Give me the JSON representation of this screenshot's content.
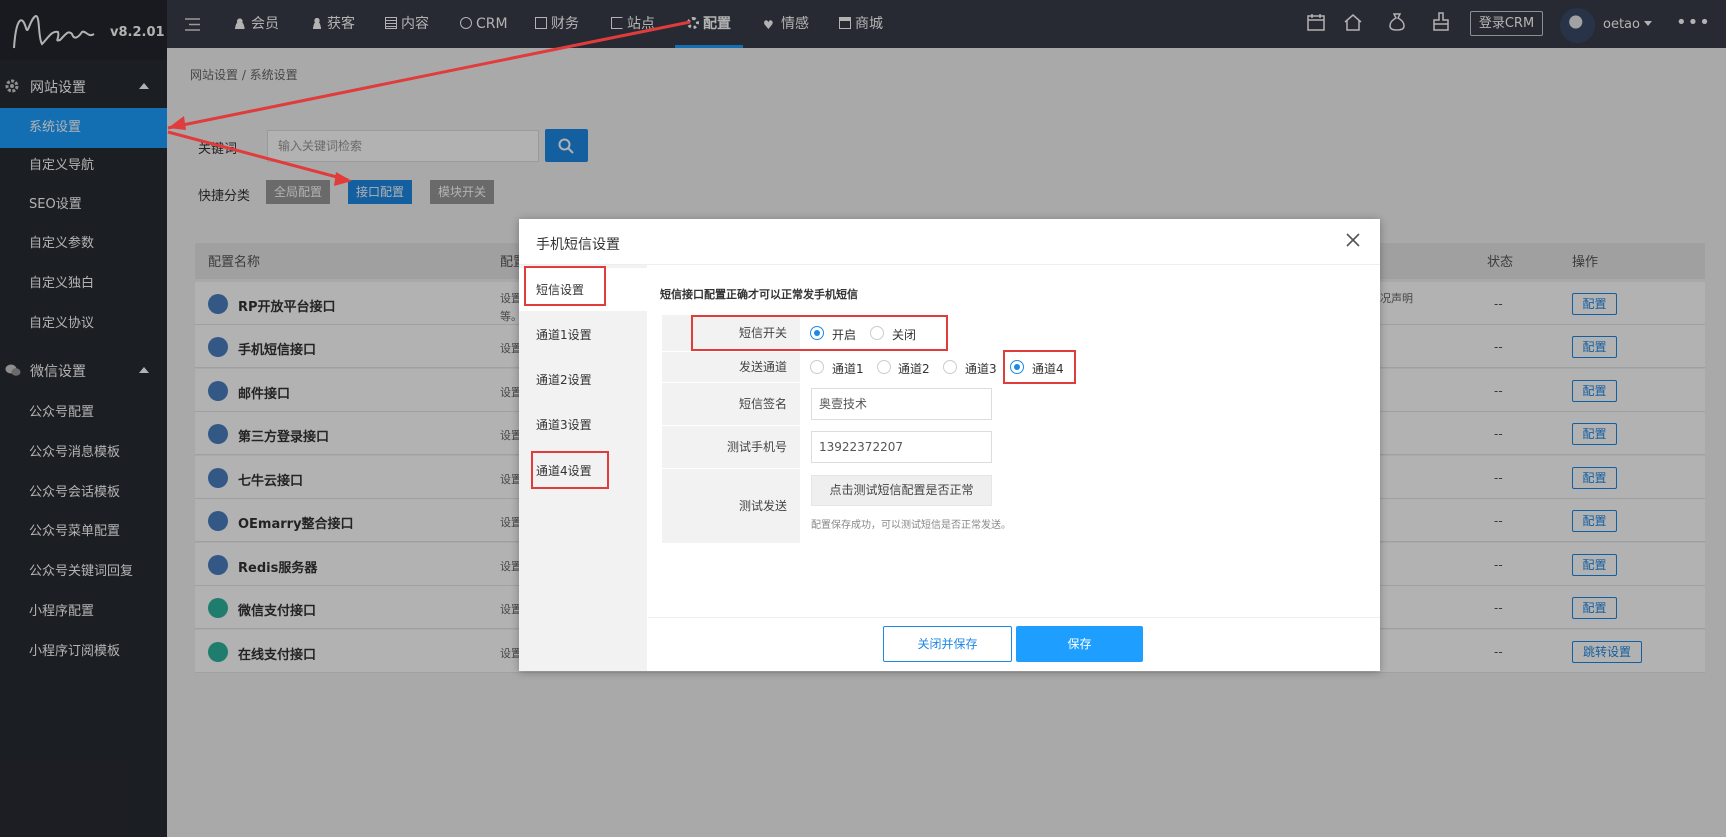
{
  "app": {
    "version": "v8.2.01"
  },
  "sidebar": {
    "groups": [
      {
        "label": "网站设置",
        "items": [
          "系统设置",
          "自定义导航",
          "SEO设置",
          "自定义参数",
          "自定义独白",
          "自定义协议"
        ]
      },
      {
        "label": "微信设置",
        "items": [
          "公众号配置",
          "公众号消息模板",
          "公众号会话模板",
          "公众号菜单配置",
          "公众号关键词回复",
          "小程序配置",
          "小程序订阅模板"
        ]
      }
    ],
    "active_item": "系统设置"
  },
  "topnav": {
    "items": [
      "会员",
      "获客",
      "内容",
      "CRM",
      "财务",
      "站点",
      "配置",
      "情感",
      "商城"
    ],
    "active": "配置",
    "login_crm": "登录CRM",
    "username": "oetao",
    "more": "•••"
  },
  "breadcrumb": "网站设置 / 系统设置",
  "search": {
    "label": "关键词",
    "placeholder": "输入关键词检索"
  },
  "quick": {
    "label": "快捷分类",
    "buttons": [
      "全局配置",
      "接口配置",
      "模块开关"
    ],
    "active": "接口配置"
  },
  "table": {
    "headers": [
      "配置名称",
      "配置",
      "状态",
      "操作"
    ],
    "rows": [
      {
        "name": "RP开放平台接口",
        "desc": "设置",
        "desc2": "等。",
        "desc_right": "况声明",
        "status": "--",
        "action": "配置"
      },
      {
        "name": "手机短信接口",
        "desc": "设置",
        "status": "--",
        "action": "配置"
      },
      {
        "name": "邮件接口",
        "desc": "设置",
        "status": "--",
        "action": "配置"
      },
      {
        "name": "第三方登录接口",
        "desc": "设置",
        "status": "--",
        "action": "配置"
      },
      {
        "name": "七牛云接口",
        "desc": "设置",
        "status": "--",
        "action": "配置"
      },
      {
        "name": "OEmarry整合接口",
        "desc": "设置",
        "status": "--",
        "action": "配置"
      },
      {
        "name": "Redis服务器",
        "desc": "设置",
        "status": "--",
        "action": "配置"
      },
      {
        "name": "微信支付接口",
        "desc": "设置",
        "status": "--",
        "action": "配置"
      },
      {
        "name": "在线支付接口",
        "desc": "设置",
        "status": "--",
        "action": "跳转设置"
      }
    ]
  },
  "modal": {
    "title": "手机短信设置",
    "tabs": [
      "短信设置",
      "通道1设置",
      "通道2设置",
      "通道3设置",
      "通道4设置"
    ],
    "note": "短信接口配置正确才可以正常发手机短信",
    "fields": {
      "switch_label": "短信开关",
      "switch_options": [
        "开启",
        "关闭"
      ],
      "switch_value": "开启",
      "channel_label": "发送通道",
      "channel_options": [
        "通道1",
        "通道2",
        "通道3",
        "通道4"
      ],
      "channel_value": "通道4",
      "sign_label": "短信签名",
      "sign_value": "奥壹技术",
      "phone_label": "测试手机号",
      "phone_value": "13922372207",
      "test_label": "测试发送",
      "test_button": "点击测试短信配置是否正常",
      "test_hint": "配置保存成功，可以测试短信是否正常发送。"
    },
    "buttons": {
      "close_save": "关闭并保存",
      "save": "保存"
    }
  },
  "colors": {
    "accent": "#1e9fff",
    "sidebar_bg": "#282b33",
    "topnav_bg": "#393d49",
    "annotation_red": "#e03c3c"
  }
}
